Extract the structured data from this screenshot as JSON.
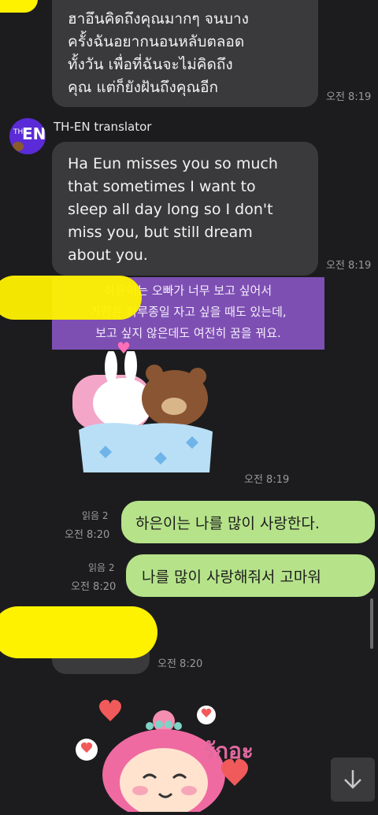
{
  "messages": {
    "thai_message": {
      "lines": [
        "ฮาอึนคิดถึงคุณมากๆ จนบาง",
        "ครั้งฉันอยากนอนหลับตลอด",
        "ทั้งวัน เพื่อที่ฉันจะไม่คิดถึง",
        "คุณ แต่ก็ยังฝันถึงคุณอีก"
      ],
      "time": "오전 8:19"
    },
    "translator": {
      "name": "TH-EN translator",
      "avatar_text": "EN",
      "avatar_small": "TH",
      "lines": [
        "Ha Eun misses you so much",
        "that sometimes I want to",
        "sleep all day long so I don't",
        "miss you, but still dream",
        "about you."
      ],
      "time": "오전 8:19"
    },
    "korean_message": {
      "lines": [
        "하은이는 오빠가 너무 보고 싶어서",
        "가끔은 하루종일 자고 싶을 때도 있는데,",
        "보고 싶지 않은데도 여전히 꿈을 꿔요."
      ]
    },
    "sticker_1": {
      "time": "오전 8:19"
    },
    "outgoing_1": {
      "text": "하은이는 나를 많이 사랑한다.",
      "read": "읽음 2",
      "time": "오전 8:20"
    },
    "outgoing_2": {
      "text": "나를 많이 사랑해줘서 고마워",
      "read": "읽음 2",
      "time": "오전 8:20"
    },
    "incoming_3": {
      "time": "오전 8:20"
    },
    "sticker_2": {
      "text": "รักอะ"
    }
  },
  "colors": {
    "background": "#1c1c1e",
    "outgoing_bubble": "#b6e38a",
    "incoming_bubble": "#3a3a3c",
    "highlight": "#fff200",
    "korean_box": "#7e4fb3"
  },
  "controls": {
    "scroll_down_icon": "arrow-down-icon"
  }
}
